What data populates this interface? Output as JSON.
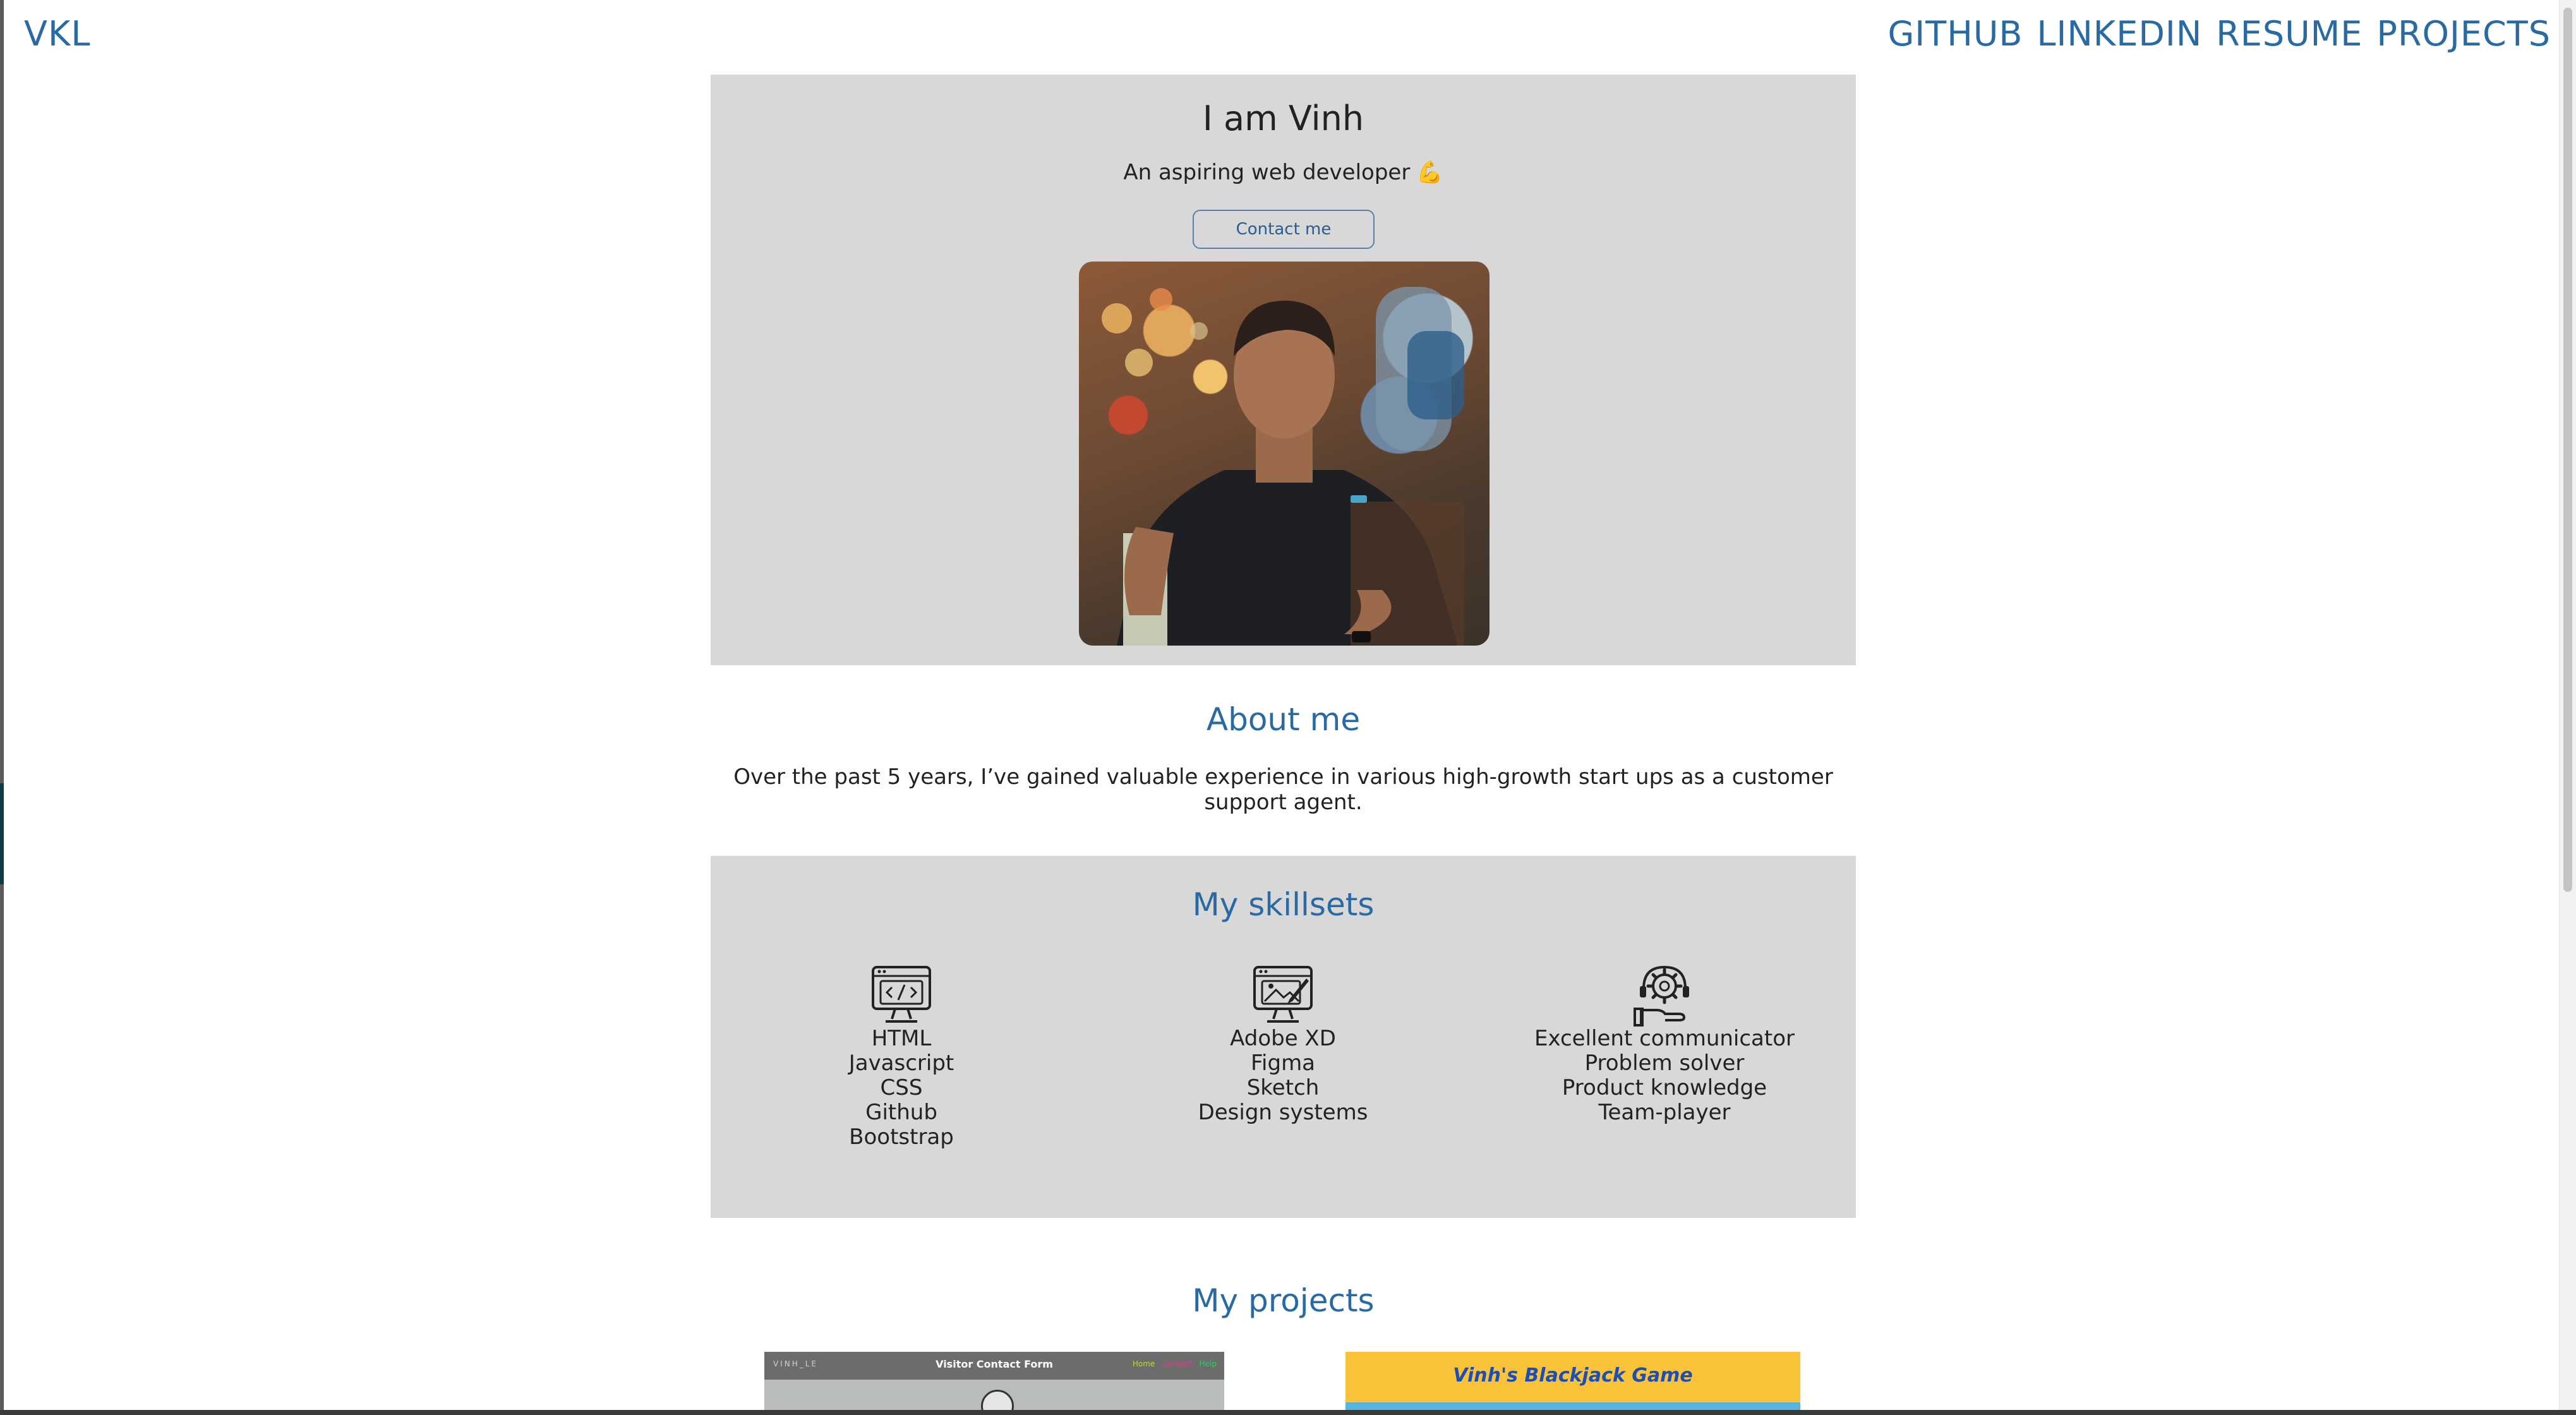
{
  "header": {
    "logo": "VKL",
    "nav": [
      "GITHUB",
      "LINKEDIN",
      "RESUME",
      "PROJECTS"
    ]
  },
  "hero": {
    "title": "I am Vinh",
    "subtitle": "An aspiring web developer",
    "subtitle_emoji": "💪",
    "contact_label": "Contact me",
    "portrait_alt": "portrait-photo"
  },
  "about": {
    "title": "About me",
    "text": "Over the past 5 years, I’ve gained valuable experience in various high-growth start ups as a customer support agent."
  },
  "skills": {
    "title": "My skillsets",
    "columns": [
      {
        "icon": "code-monitor-icon",
        "items": [
          "HTML",
          "Javascript",
          "CSS",
          "Github",
          "Bootstrap"
        ]
      },
      {
        "icon": "design-monitor-icon",
        "items": [
          "Adobe XD",
          "Figma",
          "Sketch",
          "Design systems"
        ]
      },
      {
        "icon": "support-gear-icon",
        "items": [
          "Excellent communicator",
          "Problem solver",
          "Product knowledge",
          "Team-player"
        ]
      }
    ]
  },
  "projects": {
    "title": "My projects",
    "cards": [
      {
        "title": "Visitor Contact Form",
        "brand": "VINH_LE",
        "links": [
          "Home",
          "Contact",
          "Help"
        ]
      },
      {
        "title": "Vinh's Blackjack Game"
      }
    ]
  },
  "colors": {
    "accent": "#2a6aa3",
    "panel": "#d8d8d8",
    "text": "#222222"
  }
}
